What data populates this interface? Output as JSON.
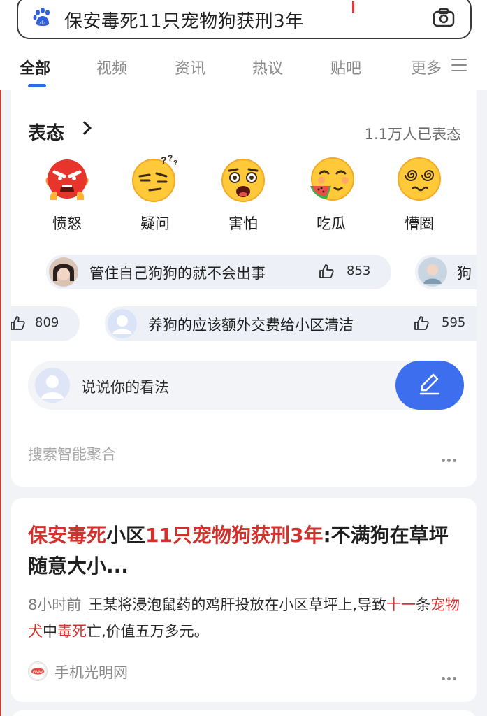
{
  "search": {
    "query": "保安毒死11只宠物狗获刑3年"
  },
  "tabs": [
    {
      "label": "全部"
    },
    {
      "label": "视频"
    },
    {
      "label": "资讯"
    },
    {
      "label": "热议"
    },
    {
      "label": "贴吧"
    },
    {
      "label": "更多"
    }
  ],
  "biaotai": {
    "title": "表态",
    "count": "1.1万人已表态",
    "reactions": [
      {
        "label": "愤怒",
        "icon": "angry-emoji-icon"
      },
      {
        "label": "疑问",
        "icon": "question-emoji-icon"
      },
      {
        "label": "害怕",
        "icon": "scared-emoji-icon"
      },
      {
        "label": "吃瓜",
        "icon": "watermelon-emoji-icon"
      },
      {
        "label": "懵圈",
        "icon": "dizzy-emoji-icon"
      }
    ],
    "comments_row1": [
      {
        "text": "管住自己狗狗的就不会出事",
        "likes": "853"
      },
      {
        "text": "狗",
        "likes": ""
      }
    ],
    "comments_row2": [
      {
        "text": "",
        "likes": "809"
      },
      {
        "text": "养狗的应该额外交费给小区清洁",
        "likes": "595"
      }
    ],
    "input_placeholder": "说说你的看法",
    "aggregate_label": "搜索智能聚合"
  },
  "news": {
    "title_parts": [
      {
        "text": "保安毒死",
        "hl": true
      },
      {
        "text": "小区",
        "hl": false
      },
      {
        "text": "11只宠物狗获刑3年",
        "hl": true
      },
      {
        "text": ":不满狗在草坪随意大小...",
        "hl": false
      }
    ],
    "time": "8小时前",
    "body_parts": [
      {
        "text": "王某将浸泡鼠药的鸡肝投放在小区草坪上,导致",
        "hl": false
      },
      {
        "text": "十一",
        "hl": true
      },
      {
        "text": "条",
        "hl": false
      },
      {
        "text": "宠物犬",
        "hl": true
      },
      {
        "text": "中",
        "hl": false
      },
      {
        "text": "毒死",
        "hl": true
      },
      {
        "text": "亡,价值五万多元。",
        "hl": false
      }
    ],
    "source": "手机光明网"
  },
  "colors": {
    "accent": "#3268ee",
    "highlight": "#d2322d"
  }
}
